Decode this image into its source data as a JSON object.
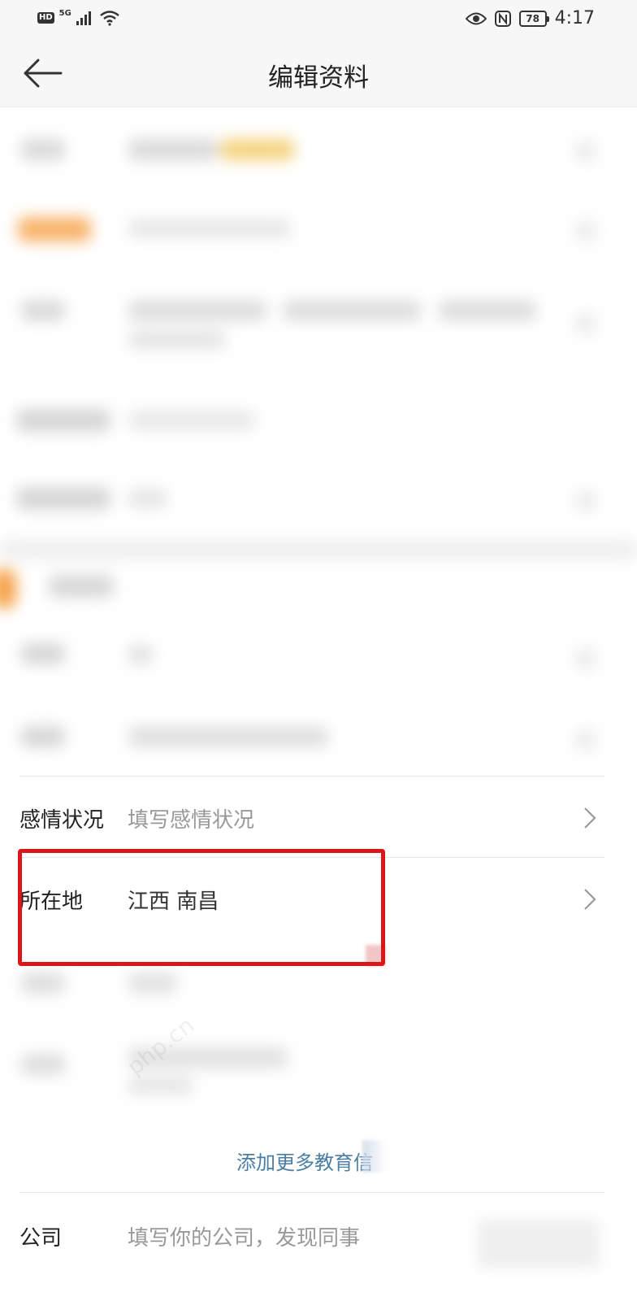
{
  "status_bar": {
    "hd": "HD",
    "network": "5G",
    "battery": "78",
    "time": "4:17"
  },
  "header": {
    "title": "编辑资料"
  },
  "rows": {
    "relationship": {
      "label": "感情状况",
      "placeholder": "填写感情状况"
    },
    "location": {
      "label": "所在地",
      "value": "江西 南昌"
    },
    "company": {
      "label": "公司",
      "placeholder": "填写你的公司，发现同事"
    }
  },
  "education": {
    "add_more": "添加更多教育信"
  },
  "colors": {
    "highlight_border": "#d9171b",
    "link": "#4a7ea3",
    "placeholder": "#999999"
  }
}
